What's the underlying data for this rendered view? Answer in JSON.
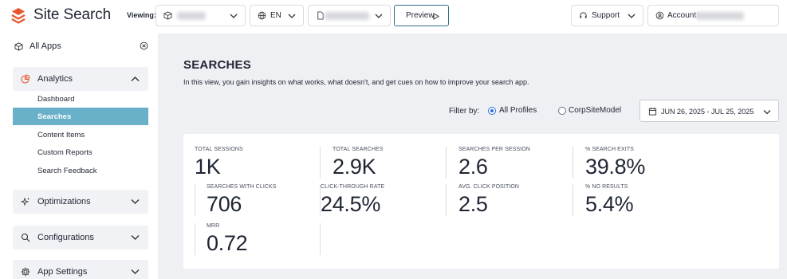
{
  "app": {
    "title": "Site Search"
  },
  "topbar": {
    "viewing_label": "Viewing:",
    "language": "EN",
    "preview_label": "Preview",
    "support_label": "Support",
    "account_label": "Account:"
  },
  "sidebar": {
    "all_apps": "All Apps",
    "groups": {
      "analytics": "Analytics",
      "optimizations": "Optimizations",
      "configurations": "Configurations",
      "app_settings": "App Settings"
    },
    "items": [
      {
        "label": "Dashboard",
        "active": false
      },
      {
        "label": "Searches",
        "active": true
      },
      {
        "label": "Content Items",
        "active": false
      },
      {
        "label": "Custom Reports",
        "active": false
      },
      {
        "label": "Search Feedback",
        "active": false
      }
    ]
  },
  "main": {
    "title": "SEARCHES",
    "description": "In this view, you gain insights on what works, what doesn't, and get cues on how to improve your search app.",
    "filter_label": "Filter by:",
    "filter_options": [
      "All Profiles",
      "CorpSiteModel"
    ],
    "filter_selected": "All Profiles",
    "date_range": "JUN 26, 2025 - JUL 25, 2025"
  },
  "metrics": [
    {
      "label": "TOTAL SESSIONS",
      "value": "1K"
    },
    {
      "label": "TOTAL SEARCHES",
      "value": "2.9K"
    },
    {
      "label": "SEARCHES PER SESSION",
      "value": "2.6"
    },
    {
      "label": "% SEARCH EXITS",
      "value": "39.8%"
    },
    {
      "label": "SEARCHES WITH CLICKS",
      "value": "706"
    },
    {
      "label": "CLICK-THROUGH RATE",
      "value": "24.5%"
    },
    {
      "label": "AVG. CLICK POSITION",
      "value": "2.5"
    },
    {
      "label": "% NO RESULTS",
      "value": "5.4%"
    },
    {
      "label": "MRR",
      "value": "0.72"
    }
  ],
  "colors": {
    "brand": "#e8552d",
    "active_item": "#69b0c9",
    "main_bg": "#eff0f4",
    "radio_selected": "#2f6fd6",
    "preview_border": "#2d6f88"
  },
  "icons": {
    "logo": "layers-logo-icon",
    "app": "cube-icon",
    "language": "globe-icon",
    "support": "headset-icon",
    "account": "user-circle-icon",
    "calendar": "calendar-icon"
  }
}
